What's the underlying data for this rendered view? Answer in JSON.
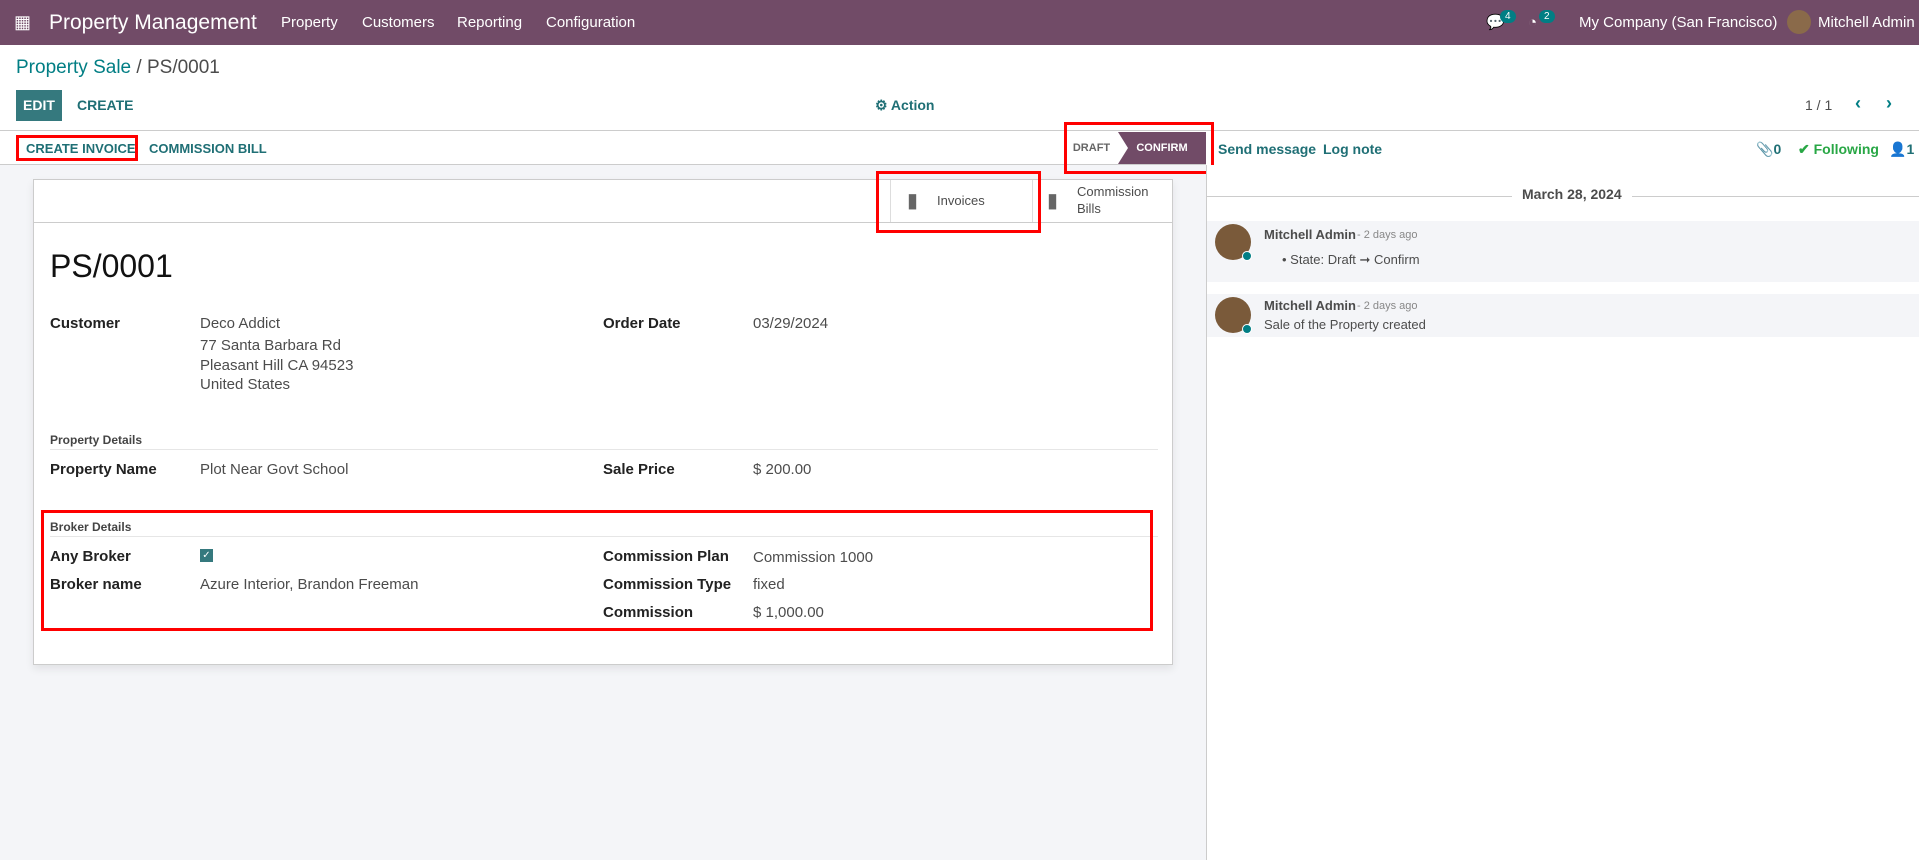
{
  "navbar": {
    "app_title": "Property Management",
    "menu": [
      "Property",
      "Customers",
      "Reporting",
      "Configuration"
    ],
    "messages_count": "4",
    "activities_count": "2",
    "company": "My Company (San Francisco)",
    "user": "Mitchell Admin"
  },
  "breadcrumb": {
    "parent": "Property Sale",
    "separator": " / ",
    "current": "PS/0001"
  },
  "toolbar": {
    "edit": "EDIT",
    "create": "CREATE",
    "action": "Action",
    "pager": "1 / 1"
  },
  "header_buttons": {
    "create_invoice": "CREATE INVOICE",
    "commission_bill": "COMMISSION BILL"
  },
  "statusbar": {
    "stages": [
      "DRAFT",
      "CONFIRM"
    ],
    "active": "CONFIRM"
  },
  "chatter_top": {
    "send_message": "Send message",
    "log_note": "Log note",
    "attachments": "0",
    "following": "Following",
    "followers": "1"
  },
  "smart_buttons": {
    "invoices": "Invoices",
    "commission_bills_1": "Commission",
    "commission_bills_2": "Bills"
  },
  "form": {
    "name": "PS/0001",
    "customer_label": "Customer",
    "customer": "Deco Addict",
    "address": [
      "77 Santa Barbara Rd",
      "Pleasant Hill CA 94523",
      "United States"
    ],
    "order_date_label": "Order Date",
    "order_date": "03/29/2024",
    "property_section": "Property Details",
    "property_name_label": "Property Name",
    "property_name": "Plot Near Govt School",
    "sale_price_label": "Sale Price",
    "sale_price": "$ 200.00",
    "broker_section": "Broker Details",
    "any_broker_label": "Any Broker",
    "any_broker": true,
    "broker_name_label": "Broker name",
    "broker_name": "Azure Interior, Brandon Freeman",
    "commission_plan_label": "Commission Plan",
    "commission_plan": "Commission 1000",
    "commission_type_label": "Commission Type",
    "commission_type": "fixed",
    "commission_label": "Commission",
    "commission": "$ 1,000.00"
  },
  "chatter": {
    "date": "March 28, 2024",
    "messages": [
      {
        "author": "Mitchell Admin",
        "time": "- 2 days ago",
        "body": "State: Draft ➞ Confirm"
      },
      {
        "author": "Mitchell Admin",
        "time": "- 2 days ago",
        "body": "Sale of the Property created"
      }
    ]
  },
  "colors": {
    "brand": "#714B67",
    "accent": "#017e84",
    "highlight": "#ff0000"
  }
}
